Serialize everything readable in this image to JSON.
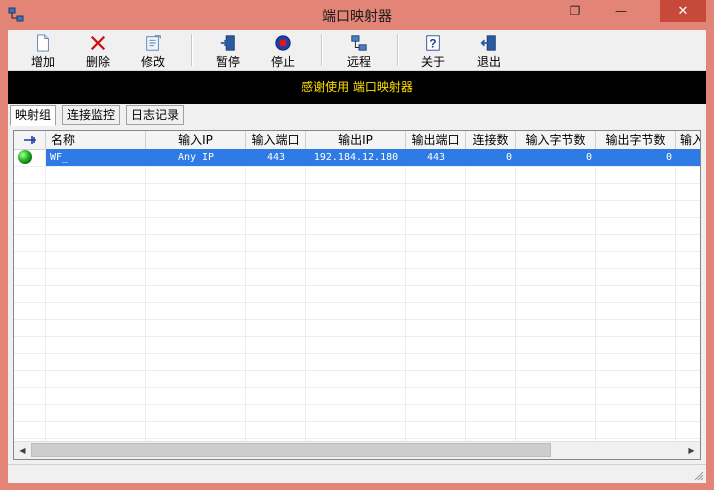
{
  "window": {
    "title": "端口映射器",
    "close_glyph": "✕",
    "minimize_glyph": "—",
    "restore_glyph": "❐",
    "accent": "#e28476",
    "close_color": "#c7493a"
  },
  "toolbar": {
    "items": [
      {
        "label": "增加",
        "icon": "new-doc-icon"
      },
      {
        "label": "删除",
        "icon": "red-x-icon"
      },
      {
        "label": "修改",
        "icon": "edit-doc-icon"
      },
      {
        "label": "暂停",
        "icon": "door-pause-icon"
      },
      {
        "label": "停止",
        "icon": "stop-icon"
      },
      {
        "label": "远程",
        "icon": "network-icon"
      },
      {
        "label": "关于",
        "icon": "help-icon"
      },
      {
        "label": "退出",
        "icon": "exit-door-icon"
      }
    ]
  },
  "banner": {
    "text": "感谢使用 端口映射器",
    "text_color": "#ffe000",
    "bg": "#000000"
  },
  "tabs": [
    {
      "label": "映射组",
      "active": true
    },
    {
      "label": "连接监控",
      "active": false
    },
    {
      "label": "日志记录",
      "active": false
    }
  ],
  "table": {
    "columns": [
      "",
      "名称",
      "输入IP",
      "输入端口",
      "输出IP",
      "输出端口",
      "连接数",
      "输入字节数",
      "输出字节数",
      "输入"
    ],
    "rows": [
      {
        "status": "running",
        "name": "WF_",
        "in_ip": "Any IP",
        "in_port": "443",
        "out_ip": "192.184.12.180",
        "out_port": "443",
        "connections": "0",
        "in_bytes": "0",
        "out_bytes": "0"
      }
    ],
    "selected_color": "#2f7be5"
  }
}
